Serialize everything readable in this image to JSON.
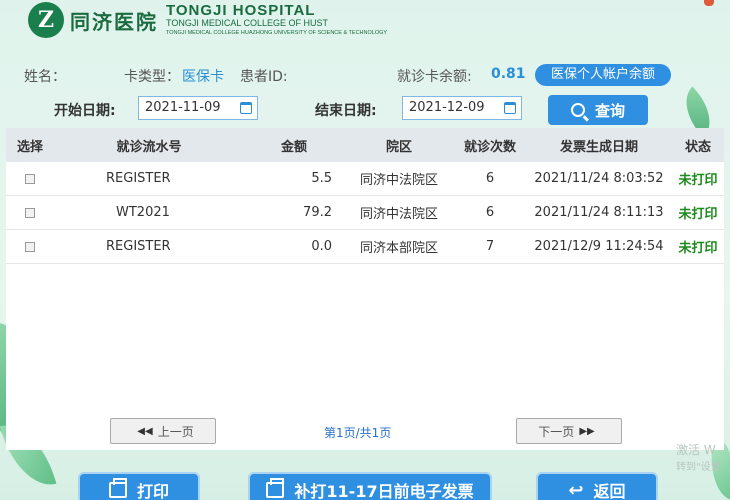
{
  "header": {
    "logo_letter": "Z",
    "hospital_cn": "同济医院",
    "hospital_en": "TONGJI HOSPITAL",
    "college_en": "TONGJI MEDICAL COLLEGE OF HUST",
    "university_en": "TONGJI MEDICAL COLLEGE HUAZHONG UNIVERSITY OF SCIENCE & TECHNOLOGY"
  },
  "info": {
    "name_label": "姓名：",
    "name_value": "",
    "card_type_label": "卡类型：",
    "card_type_value": "医保卡",
    "patient_id_label": "患者ID:",
    "patient_id_value": "",
    "balance_label": "就诊卡余额:",
    "balance_value": "0.81",
    "personal_balance_button": "医保个人帐户余额"
  },
  "dates": {
    "start_label": "开始日期:",
    "start_value": "2021-11-09",
    "end_label": "结束日期:",
    "end_value": "2021-12-09",
    "search_button": "查询"
  },
  "table": {
    "headers": [
      "选择",
      "就诊流水号",
      "金额",
      "院区",
      "就诊次数",
      "发票生成日期",
      "状态"
    ],
    "rows": [
      {
        "serial": "REGISTER",
        "amount": "5.5",
        "campus": "同济中法院区",
        "visits": "6",
        "date": "2021/11/24 8:03:52",
        "status": "未打印"
      },
      {
        "serial": "WT2021",
        "amount": "79.2",
        "campus": "同济中法院区",
        "visits": "6",
        "date": "2021/11/24 8:11:13",
        "status": "未打印"
      },
      {
        "serial": "REGISTER",
        "amount": "0.0",
        "campus": "同济本部院区",
        "visits": "7",
        "date": "2021/12/9 11:24:54",
        "status": "未打印"
      }
    ]
  },
  "pager": {
    "prev": "上一页",
    "info": "第1页/共1页",
    "next": "下一页"
  },
  "actions": {
    "print": "打印",
    "reprint": "补打11-17日前电子发票",
    "back": "返回"
  },
  "watermark": {
    "line1": "激活 W",
    "line2": "转到\"设置"
  },
  "colors": {
    "accent": "#2f8fe0",
    "status_green": "#1c8a1c",
    "brand_green": "#1a6b40"
  }
}
